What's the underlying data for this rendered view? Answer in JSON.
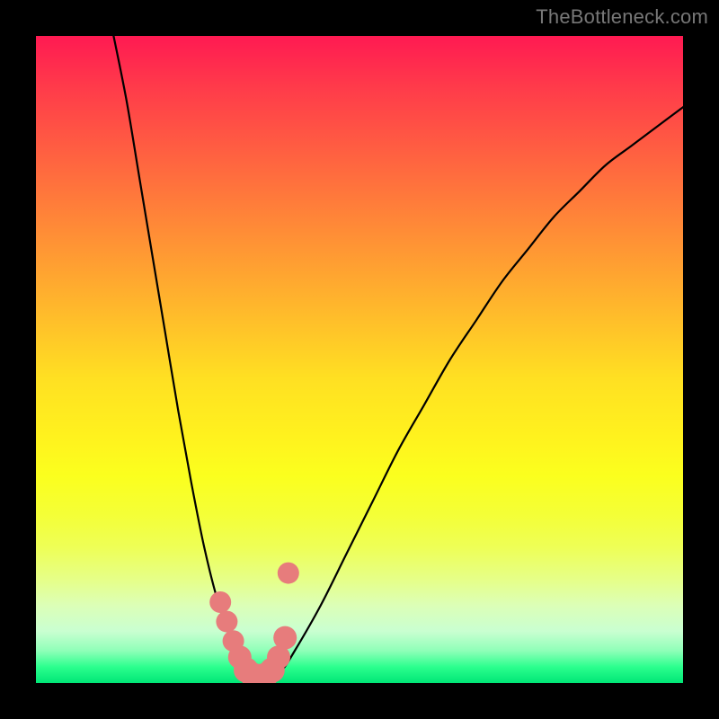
{
  "watermark": {
    "text": "TheBottleneck.com"
  },
  "chart_data": {
    "type": "line",
    "title": "",
    "xlabel": "",
    "ylabel": "",
    "xlim": [
      0,
      100
    ],
    "ylim": [
      0,
      100
    ],
    "minimum_x": 34,
    "series": [
      {
        "name": "bottleneck-curve",
        "x": [
          12,
          14,
          16,
          18,
          20,
          22,
          24,
          26,
          28,
          30,
          32,
          34,
          36,
          38,
          40,
          44,
          48,
          52,
          56,
          60,
          64,
          68,
          72,
          76,
          80,
          84,
          88,
          92,
          96,
          100
        ],
        "values": [
          100,
          90,
          78,
          66,
          54,
          42,
          31,
          21,
          13,
          7,
          3,
          1,
          1,
          2,
          5,
          12,
          20,
          28,
          36,
          43,
          50,
          56,
          62,
          67,
          72,
          76,
          80,
          83,
          86,
          89
        ]
      }
    ],
    "markers": {
      "name": "highlighted-points",
      "color": "#e77c7c",
      "x": [
        28.5,
        29.5,
        30.5,
        31.5,
        32.5,
        33.5,
        34.5,
        35.5,
        36.5,
        37.5,
        38.5,
        39
      ],
      "values": [
        12.5,
        9.5,
        6.5,
        4.0,
        2.0,
        1.2,
        1.0,
        1.2,
        2.0,
        4.0,
        7.0,
        17.0
      ],
      "size": [
        12,
        12,
        12,
        13,
        14,
        14,
        14,
        14,
        14,
        13,
        13,
        12
      ]
    }
  }
}
